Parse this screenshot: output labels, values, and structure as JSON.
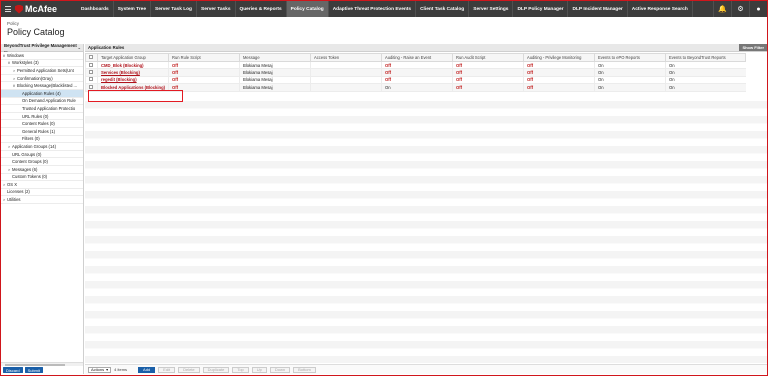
{
  "brand": {
    "name": "McAfee"
  },
  "nav": {
    "tabs": [
      "Dashboards",
      "System Tree",
      "Server Task Log",
      "Server Tasks",
      "Queries & Reports",
      "Policy Catalog",
      "Adaptive Threat Protection Events",
      "Client Task Catalog",
      "Server Settings",
      "DLP Policy Manager",
      "DLP Incident Manager",
      "Active Response Search"
    ],
    "active": "Policy Catalog"
  },
  "header": {
    "breadcrumb": "Policy",
    "title": "Policy Catalog"
  },
  "left": {
    "title": "BeyondTrust Privilege Management ...",
    "tree": [
      {
        "label": "Windows",
        "twisty": "∨",
        "indent": 0
      },
      {
        "label": "Workstyles (3)",
        "twisty": "∨",
        "indent": 1
      },
      {
        "label": "Permitted Application Sets(Unt",
        "twisty": ">",
        "indent": 2
      },
      {
        "label": "Confirmation(Gray)",
        "twisty": ">",
        "indent": 2
      },
      {
        "label": "Blocking Message(Blacklisted ...",
        "twisty": "∨",
        "indent": 2
      },
      {
        "label": "Application Rules (4)",
        "twisty": "",
        "indent": 3,
        "selected": true
      },
      {
        "label": "On Demand Application Rule",
        "twisty": "",
        "indent": 3
      },
      {
        "label": "Trusted Application Protectio",
        "twisty": "",
        "indent": 3
      },
      {
        "label": "URL Rules (0)",
        "twisty": "",
        "indent": 3
      },
      {
        "label": "Content Rules (0)",
        "twisty": "",
        "indent": 3
      },
      {
        "label": "General Rules (1)",
        "twisty": "",
        "indent": 3
      },
      {
        "label": "Filters (0)",
        "twisty": "",
        "indent": 3
      },
      {
        "label": "Application Groups (14)",
        "twisty": ">",
        "indent": 1
      },
      {
        "label": "URL Groups (0)",
        "twisty": "",
        "indent": 1
      },
      {
        "label": "Content Groups (0)",
        "twisty": "",
        "indent": 1
      },
      {
        "label": "Messages (6)",
        "twisty": ">",
        "indent": 1
      },
      {
        "label": "Custom Tokens (0)",
        "twisty": "",
        "indent": 1
      },
      {
        "label": "OS X",
        "twisty": ">",
        "indent": 0
      },
      {
        "label": "Licenses (2)",
        "twisty": "",
        "indent": 0
      },
      {
        "label": "Utilities",
        "twisty": ">",
        "indent": 0
      }
    ],
    "buttons": {
      "discard": "Discard",
      "submit": "Submit"
    }
  },
  "right": {
    "title": "Application Rules",
    "show_filter": "Show Filter",
    "columns": [
      "Target Application Group",
      "Run Rule Script",
      "Message",
      "Access Token",
      "Auditing - Raise an Event",
      "Run Audit Script",
      "Auditing - Privilege Monitoring",
      "Events to ePO Reports",
      "Events to BeyondTrust Reports"
    ],
    "rows": [
      [
        "CMD_Blok (Blocking)",
        "Off",
        "Blokiama Mesaj",
        "",
        "Off",
        "Off",
        "Off",
        "On",
        "On"
      ],
      [
        "Services (Blocking)",
        "Off",
        "Blokiama Mesaj",
        "",
        "Off",
        "Off",
        "Off",
        "On",
        "On"
      ],
      [
        "regedit (Blocking)",
        "Off",
        "Blokiama Mesaj",
        "",
        "Off",
        "Off",
        "Off",
        "On",
        "On"
      ],
      [
        "Blocked Applications (Blocking)",
        "Off",
        "Blokiama Mesaj",
        "",
        "On",
        "Off",
        "Off",
        "On",
        "On"
      ]
    ],
    "footer": {
      "actions": "Actions",
      "items": "4 items",
      "buttons": [
        "Add",
        "Edit",
        "Delete",
        "Duplicate",
        "Top",
        "Up",
        "Down",
        "Bottom"
      ]
    }
  }
}
